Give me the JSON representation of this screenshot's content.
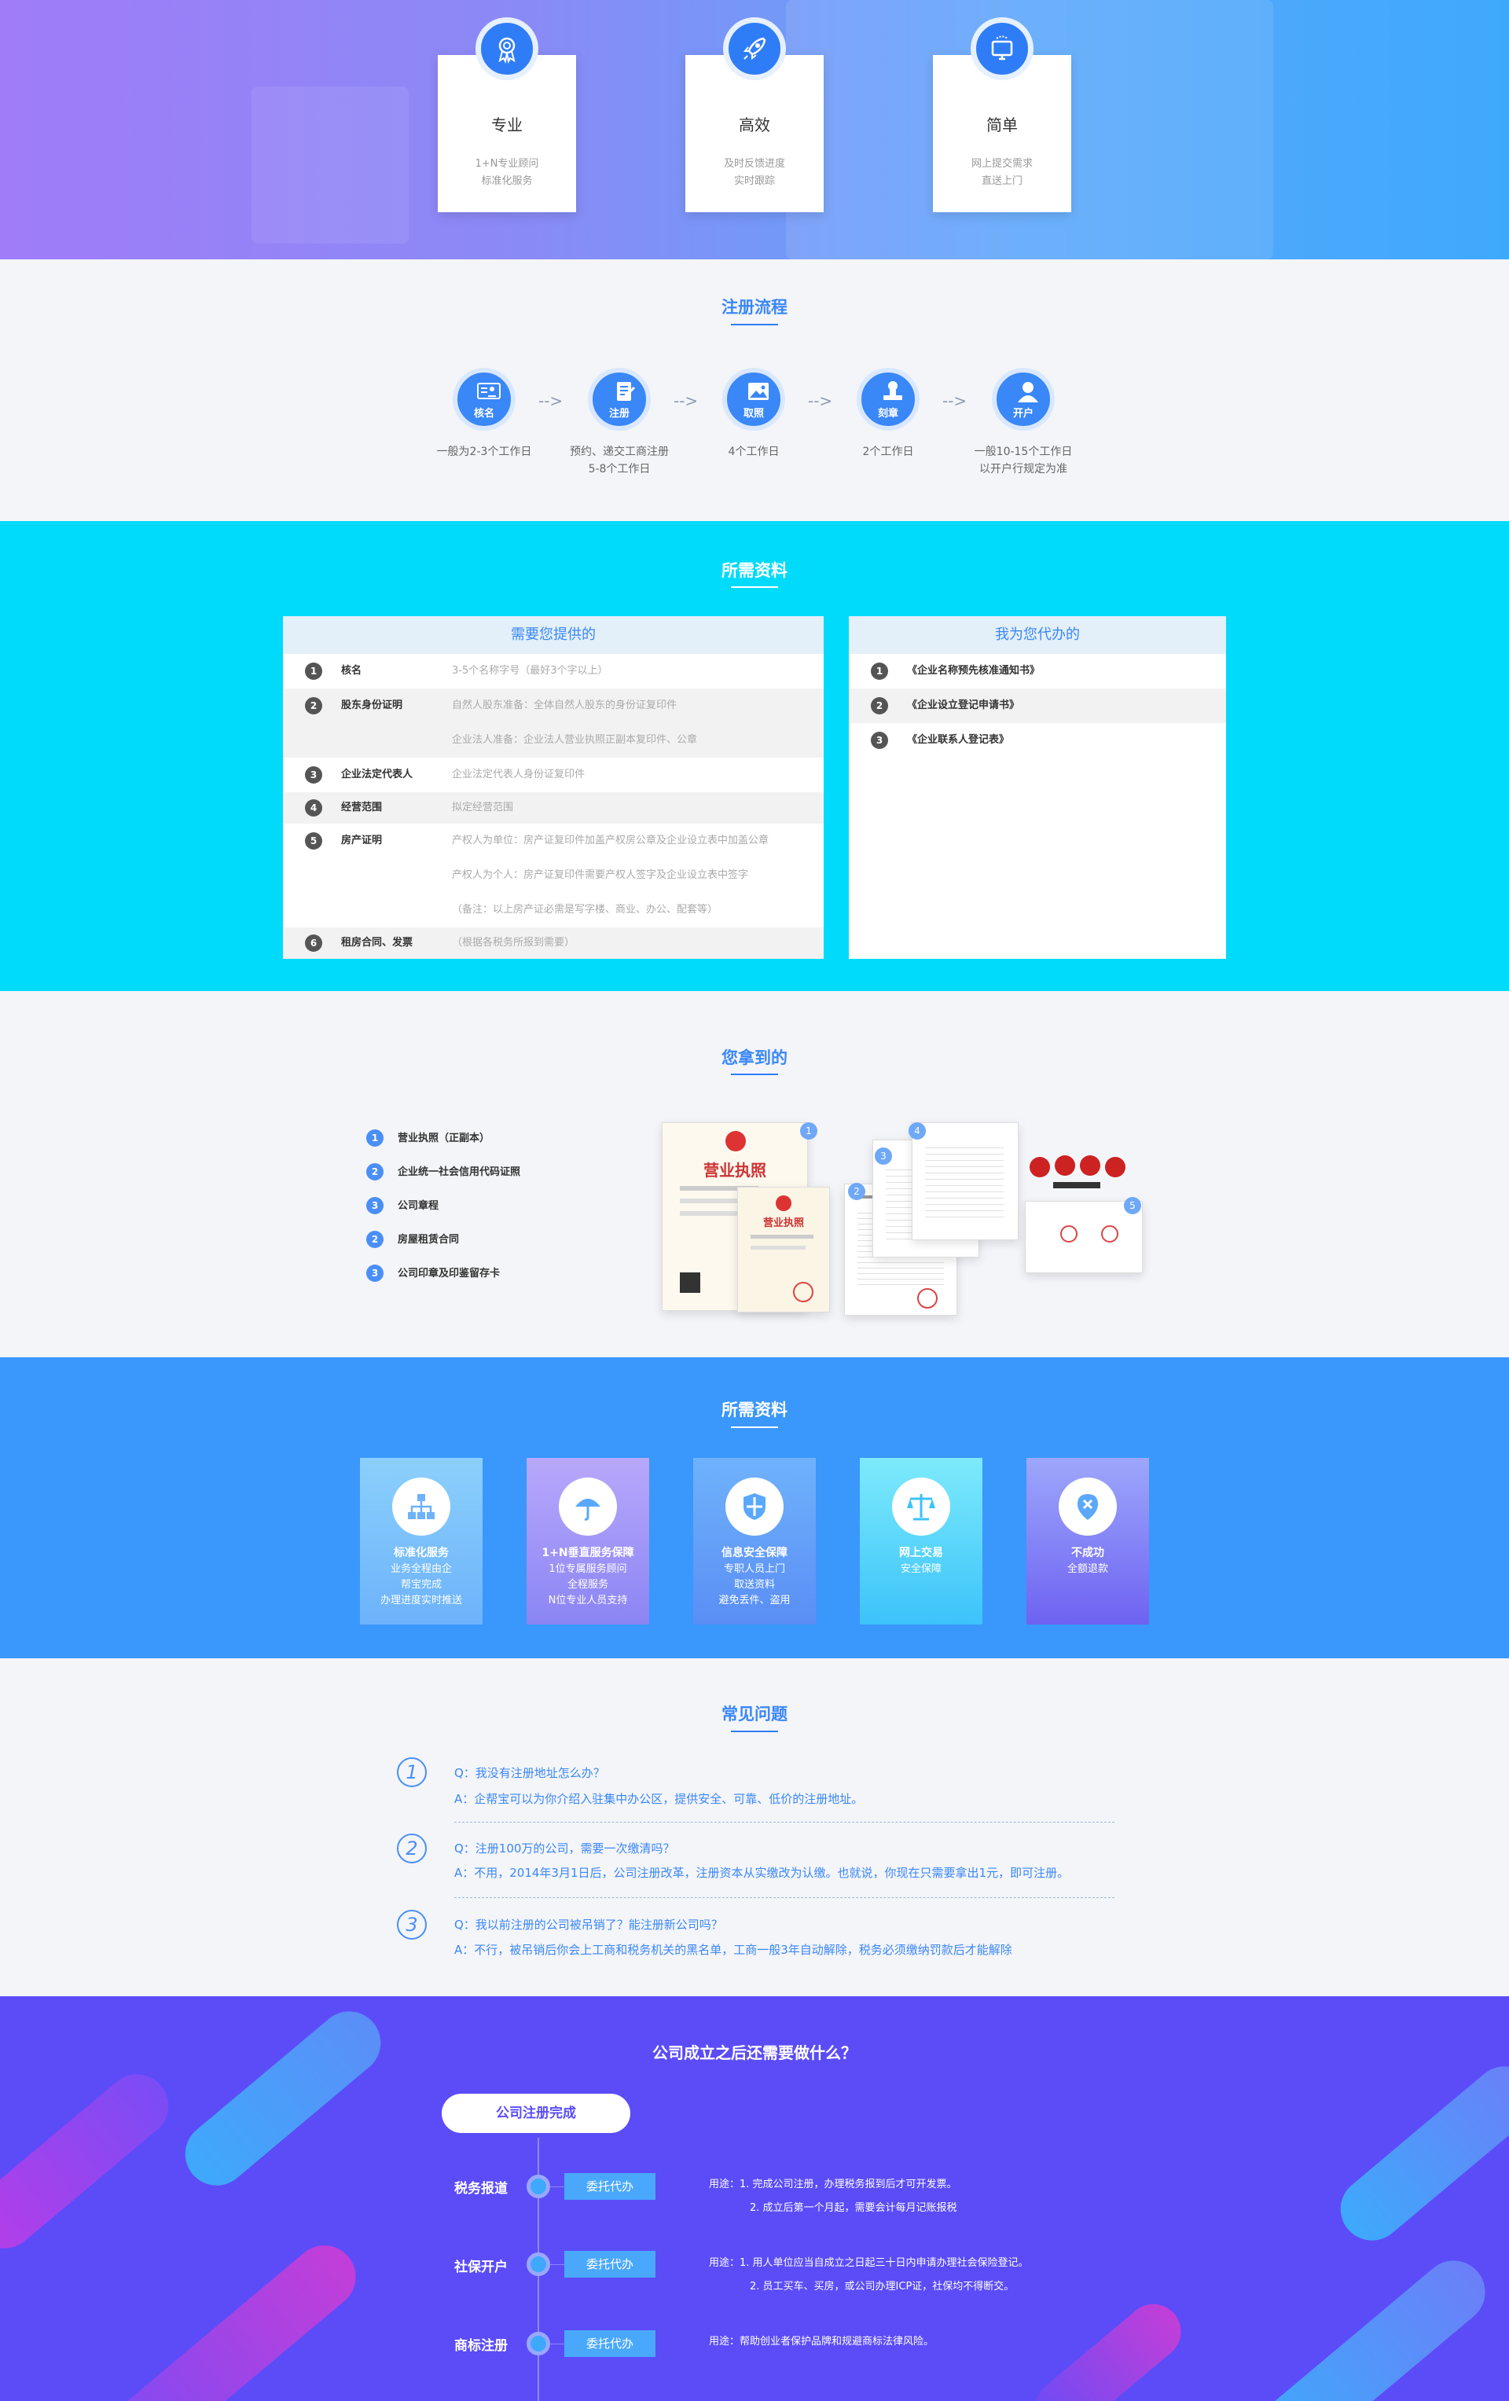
{
  "features": [
    {
      "icon": "award-icon",
      "title": "专业",
      "desc1": "1+N专业顾问",
      "desc2": "标准化服务"
    },
    {
      "icon": "rocket-icon",
      "title": "高效",
      "desc1": "及时反馈进度",
      "desc2": "实时跟踪"
    },
    {
      "icon": "monitor-icon",
      "title": "简单",
      "desc1": "网上提交需求",
      "desc2": "直送上门"
    }
  ],
  "flow": {
    "title": "注册流程",
    "steps": [
      {
        "label": "核名",
        "desc1": "一般为2-3个工作日",
        "desc2": ""
      },
      {
        "label": "注册",
        "desc1": "预约、递交工商注册",
        "desc2": "5-8个工作日"
      },
      {
        "label": "取照",
        "desc1": "4个工作日",
        "desc2": ""
      },
      {
        "label": "刻章",
        "desc1": "2个工作日",
        "desc2": ""
      },
      {
        "label": "开户",
        "desc1": "一般10-15个工作日",
        "desc2": "以开户行规定为准"
      }
    ],
    "arrow": "-->"
  },
  "materials": {
    "title": "所需资料",
    "left": {
      "header": "需要您提供的",
      "rows": [
        {
          "num": "1",
          "key": "核名",
          "val": "3-5个名称字号（最好3个字以上）"
        },
        {
          "num": "2",
          "key": "股东身份证明",
          "val": "自然人股东准备：全体自然人股东的身份证复印件"
        },
        {
          "num": "",
          "key": "",
          "val": "企业法人准备：企业法人营业执照正副本复印件、公章"
        },
        {
          "num": "3",
          "key": "企业法定代表人",
          "val": "企业法定代表人身份证复印件"
        },
        {
          "num": "4",
          "key": "经营范围",
          "val": "拟定经营范围"
        },
        {
          "num": "5",
          "key": "房产证明",
          "val": "产权人为单位：房产证复印件加盖产权房公章及企业设立表中加盖公章"
        },
        {
          "num": "",
          "key": "",
          "val": "产权人为个人：房产证复印件需要产权人签字及企业设立表中签字"
        },
        {
          "num": "",
          "key": "",
          "val": "（备注：以上房产证必需是写字楼、商业、办公、配套等）"
        },
        {
          "num": "6",
          "key": "租房合同、发票",
          "val": "（根据各税务所报到需要）"
        }
      ]
    },
    "right": {
      "header": "我为您代办的",
      "rows": [
        {
          "num": "1",
          "key": "《企业名称预先核准通知书》"
        },
        {
          "num": "2",
          "key": "《企业设立登记申请书》"
        },
        {
          "num": "3",
          "key": "《企业联系人登记表》"
        }
      ]
    }
  },
  "get": {
    "title": "您拿到的",
    "items": [
      {
        "num": "1",
        "label": "营业执照（正副本）"
      },
      {
        "num": "2",
        "label": "企业统一社会信用代码证照"
      },
      {
        "num": "3",
        "label": "公司章程"
      },
      {
        "num": "2",
        "label": "房屋租赁合同"
      },
      {
        "num": "3",
        "label": "公司印章及印鉴留存卡"
      }
    ],
    "license_text": "营业执照",
    "doc_badges": [
      "1",
      "2",
      "3",
      "4",
      "5"
    ]
  },
  "service": {
    "title": "所需资料",
    "cards": [
      {
        "icon": "org-chart-icon",
        "title": "标准化服务",
        "lines": [
          "业务全程由企",
          "帮宝完成",
          "办理进度实时推送"
        ],
        "color1": "#8bd0fb",
        "color2": "#6db2fb"
      },
      {
        "icon": "umbrella-icon",
        "title": "1+N垂直服务保障",
        "lines": [
          "1位专属服务顾问",
          "全程服务",
          "N位专业人员支持"
        ],
        "color1": "#b8a8fb",
        "color2": "#8b85f4"
      },
      {
        "icon": "shield-icon",
        "title": "信息安全保障",
        "lines": [
          "专职人员上门",
          "取送资料",
          "避免丢件、盗用"
        ],
        "color1": "#6fb2fb",
        "color2": "#5a8ef5"
      },
      {
        "icon": "scale-icon",
        "title": "网上交易",
        "lines": [
          "安全保障"
        ],
        "color1": "#7deafb",
        "color2": "#3cc3fa"
      },
      {
        "icon": "close-circle-icon",
        "title": "不成功",
        "lines": [
          "全额退款"
        ],
        "color1": "#9da7fb",
        "color2": "#6e62f2"
      }
    ]
  },
  "faq": {
    "title": "常见问题",
    "items": [
      {
        "num": "1",
        "q": "Q：我没有注册地址怎么办？",
        "a": "A：企帮宝可以为你介绍入驻集中办公区，提供安全、可靠、低价的注册地址。"
      },
      {
        "num": "2",
        "q": "Q：注册100万的公司，需要一次缴清吗？",
        "a": "A：不用，2014年3月1日后，公司注册改革，注册资本从实缴改为认缴。也就说，你现在只需要拿出1元，即可注册。"
      },
      {
        "num": "3",
        "q": "Q：我以前注册的公司被吊销了？能注册新公司吗？",
        "a": "A：不行，被吊销后你会上工商和税务机关的黑名单，工商一般3年自动解除，税务必须缴纳罚款后才能解除"
      }
    ]
  },
  "after": {
    "title": "公司成立之后还需要做什么？",
    "start": "公司注册完成",
    "items": [
      {
        "label": "税务报道",
        "btn": "委托代办",
        "use1": "用途：1. 完成公司注册，办理税务报到后才可开发票。",
        "use2": "2. 成立后第一个月起，需要会计每月记账报税"
      },
      {
        "label": "社保开户",
        "btn": "委托代办",
        "use1": "用途：1. 用人单位应当自成立之日起三十日内申请办理社会保险登记。",
        "use2": "2. 员工买车、买房，或公司办理ICP证，社保均不得断交。"
      },
      {
        "label": "商标注册",
        "btn": "委托代办",
        "use1": "用途：帮助创业者保护品牌和规避商标法律风险。",
        "use2": ""
      }
    ]
  }
}
